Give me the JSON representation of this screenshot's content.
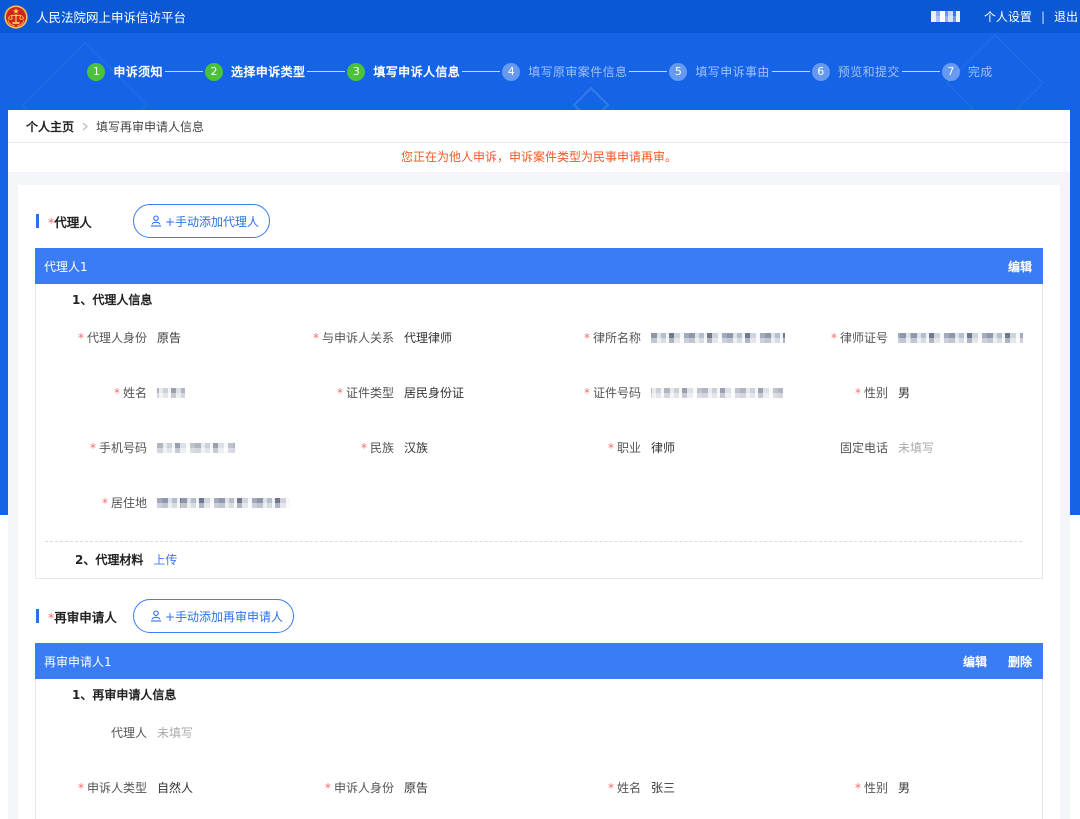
{
  "colors": {
    "primary": "#3a7cf4",
    "link": "#2e6fe8",
    "banner": "#1563e6",
    "topbar": "#0b58d6",
    "step_done": "#4cc13a",
    "notice": "#f05a28",
    "required": "#f56c6c"
  },
  "icons": {
    "logo": "court-emblem",
    "add_person": "user-add-icon",
    "breadcrumb_separator": "chevron-right-icon"
  },
  "header": {
    "title": "人民法院网上申诉信访平台",
    "settings": "个人设置",
    "separator": "|",
    "logout": "退出"
  },
  "steps": [
    {
      "num": "1",
      "label": "申诉须知",
      "done": true
    },
    {
      "num": "2",
      "label": "选择申诉类型",
      "done": true
    },
    {
      "num": "3",
      "label": "填写申诉人信息",
      "done": true
    },
    {
      "num": "4",
      "label": "填写原审案件信息",
      "done": false
    },
    {
      "num": "5",
      "label": "填写申诉事由",
      "done": false
    },
    {
      "num": "6",
      "label": "预览和提交",
      "done": false
    },
    {
      "num": "7",
      "label": "完成",
      "done": false
    }
  ],
  "breadcrumb": {
    "home": "个人主页",
    "current": "填写再审申请人信息"
  },
  "notice": "您正在为他人申诉，申诉案件类型为民事申请再审。",
  "form": {
    "required_mark": "*"
  },
  "agent": {
    "section_title": "代理人",
    "add_button": "+手动添加代理人",
    "card_title": "代理人1",
    "edit": "编辑",
    "info_heading": "1、代理人信息",
    "fields": [
      {
        "label": "代理人身份",
        "value": "原告"
      },
      {
        "label": "与申诉人关系",
        "value": "代理律师"
      },
      {
        "label": "律所名称"
      },
      {
        "label": "律师证号"
      },
      {
        "label": "姓名"
      },
      {
        "label": "证件类型",
        "value": "居民身份证"
      },
      {
        "label": "证件号码"
      },
      {
        "label": "性别",
        "value": "男"
      },
      {
        "label": "手机号码"
      },
      {
        "label": "民族",
        "value": "汉族"
      },
      {
        "label": "职业",
        "value": "律师"
      },
      {
        "label": "固定电话",
        "value": "未填写"
      },
      {
        "label": "居住地"
      }
    ],
    "materials_heading": "2、代理材料",
    "upload": "上传"
  },
  "applicant": {
    "section_title": "再审申请人",
    "add_button": "+手动添加再审申请人",
    "card_title": "再审申请人1",
    "edit": "编辑",
    "delete": "删除",
    "info_heading": "1、再审申请人信息",
    "fields": [
      {
        "label": "代理人",
        "value": "未填写"
      },
      {
        "label": "申诉人类型",
        "value": "自然人"
      },
      {
        "label": "申诉人身份",
        "value": "原告"
      },
      {
        "label": "姓名",
        "value": "张三"
      },
      {
        "label": "性别",
        "value": "男"
      }
    ]
  }
}
